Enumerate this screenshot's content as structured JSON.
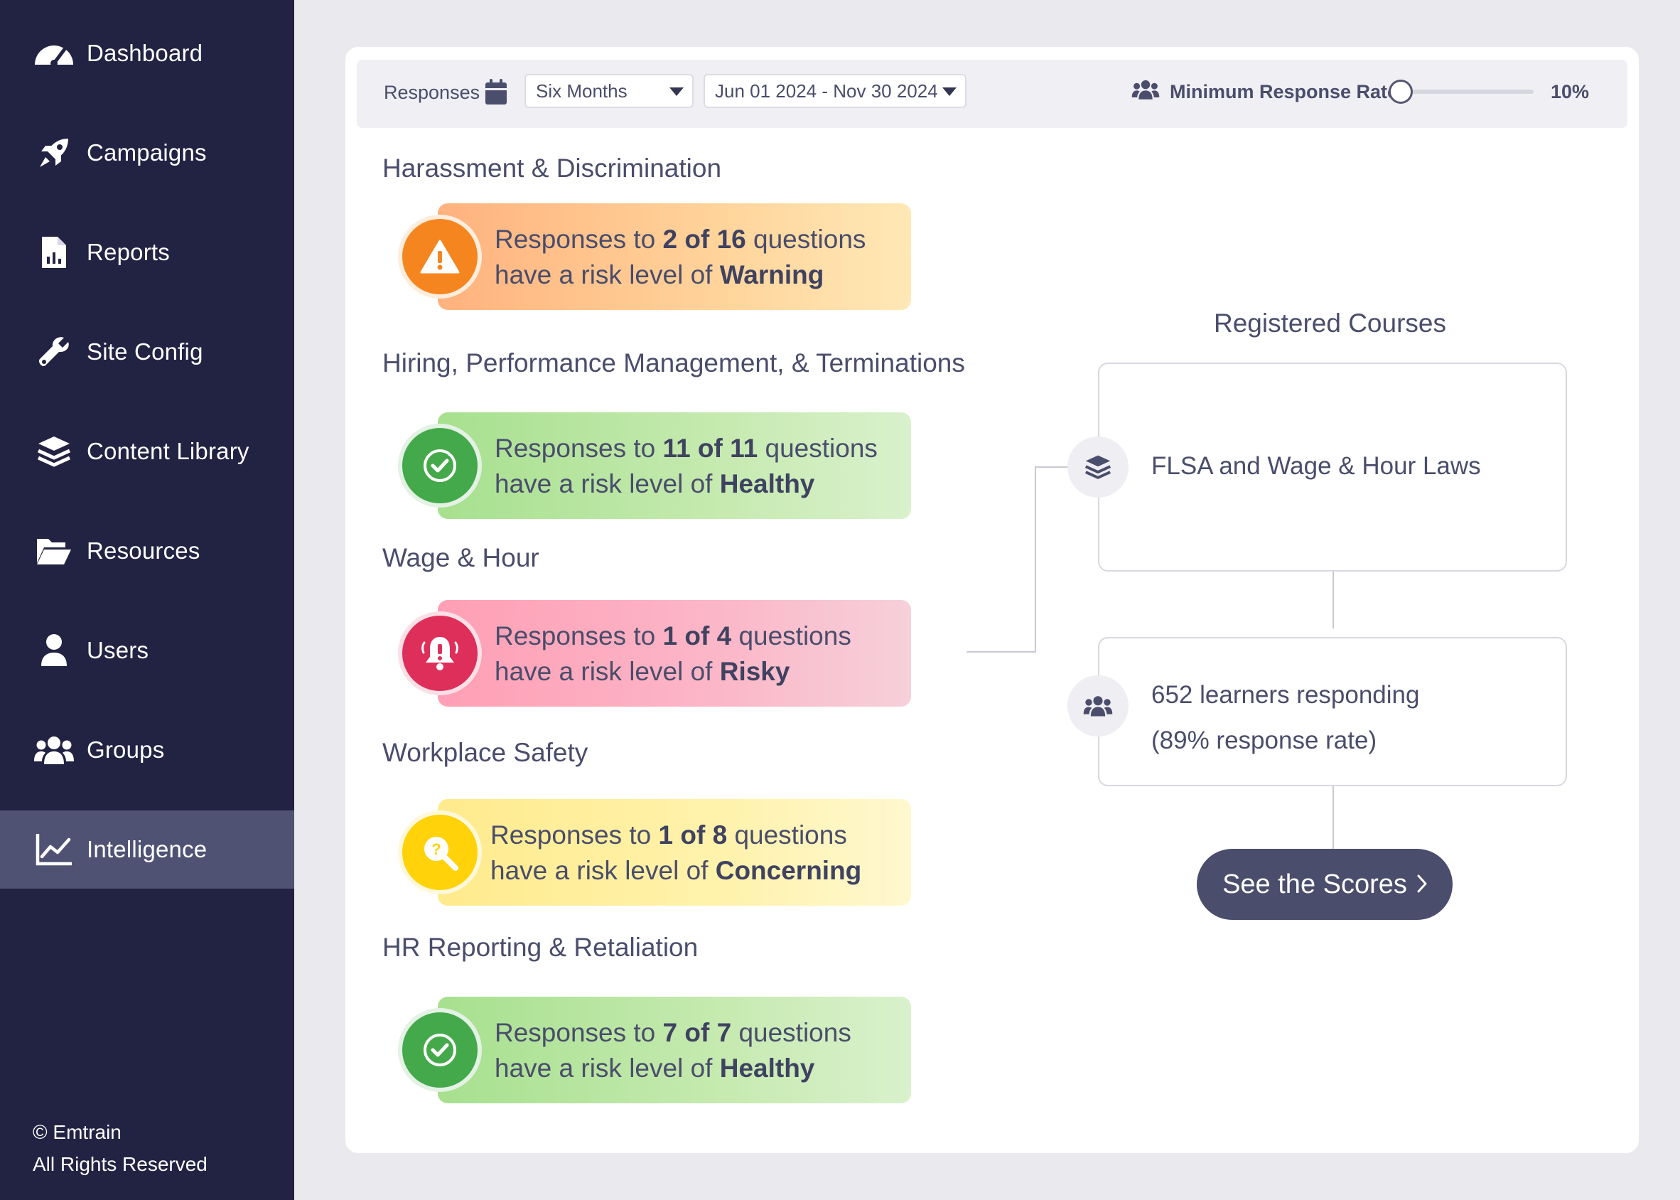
{
  "sidebar": {
    "items": [
      {
        "label": "Dashboard",
        "icon": "dashboard-icon"
      },
      {
        "label": "Campaigns",
        "icon": "rocket-icon"
      },
      {
        "label": "Reports",
        "icon": "report-file-icon"
      },
      {
        "label": "Site Config",
        "icon": "wrench-icon"
      },
      {
        "label": "Content Library",
        "icon": "layers-icon"
      },
      {
        "label": "Resources",
        "icon": "folder-open-icon"
      },
      {
        "label": "Users",
        "icon": "user-icon"
      },
      {
        "label": "Groups",
        "icon": "users-icon"
      },
      {
        "label": "Intelligence",
        "icon": "chart-line-icon",
        "active": true
      }
    ],
    "copyright_line1": "© Emtrain",
    "copyright_line2": "All Rights Reserved"
  },
  "toolbar": {
    "responses_label": "Responses",
    "period_select": "Six Months",
    "date_range_select": "Jun 01 2024 - Nov 30 2024",
    "min_rate_label": "Minimum Response Rate",
    "min_rate_value": "10%",
    "min_rate_fraction": 0.1
  },
  "categories": [
    {
      "title": "Harassment & Discrimination",
      "prefix": "Responses to ",
      "count": "2 of 16",
      "mid": " questions",
      "line2": "have a risk level of ",
      "level": "Warning"
    },
    {
      "title": "Hiring, Performance Management, & Terminations",
      "prefix": "Responses to ",
      "count": "11 of 11",
      "mid": " questions",
      "line2": "have a risk level of ",
      "level": "Healthy"
    },
    {
      "title": "Wage & Hour",
      "prefix": "Responses to ",
      "count": "1 of 4",
      "mid": " questions",
      "line2": "have a risk level of ",
      "level": "Risky"
    },
    {
      "title": "Workplace Safety",
      "prefix": "Responses to ",
      "count": "1 of 8",
      "mid": " questions",
      "line2": "have a risk level of ",
      "level": "Concerning"
    },
    {
      "title": "HR Reporting & Retaliation",
      "prefix": "Responses to ",
      "count": "7 of 7",
      "mid": " questions",
      "line2": "have a risk level of ",
      "level": "Healthy"
    }
  ],
  "courses": {
    "title": "Registered Courses",
    "course_name": "FLSA and Wage & Hour Laws",
    "learners_line1": "652 learners responding",
    "learners_line2": "(89% response rate)",
    "cta_label": "See the Scores"
  },
  "colors": {
    "sidebar_bg": "#222243",
    "sidebar_active": "#4f5273",
    "warning": "#f5861f",
    "healthy": "#44a94a",
    "risky": "#de2f5a",
    "concerning": "#ffd20a",
    "cta_bg": "#4a4d6b"
  }
}
